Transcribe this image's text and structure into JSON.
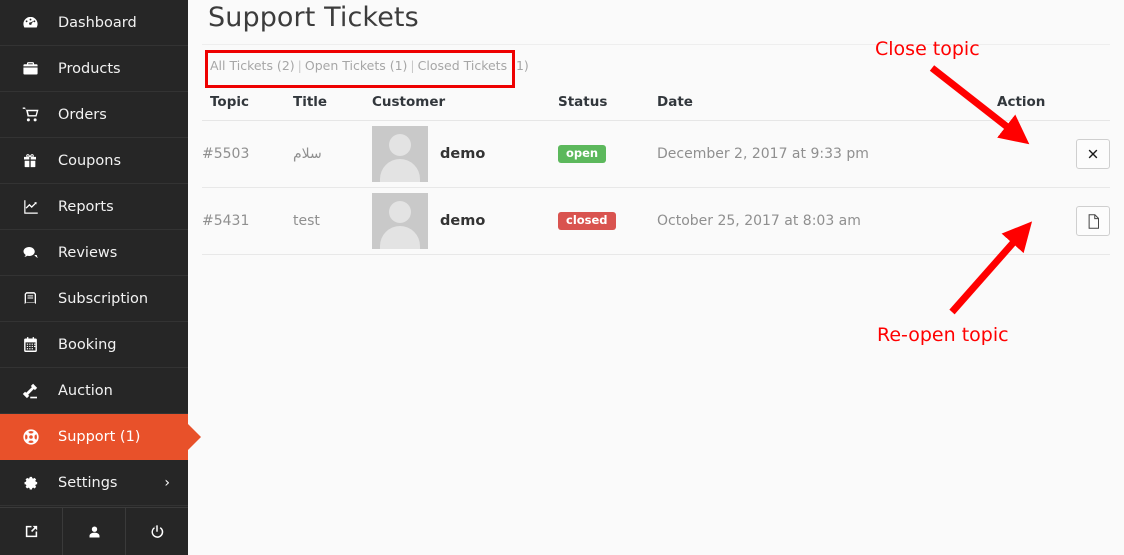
{
  "sidebar": {
    "items": [
      {
        "label": "Dashboard",
        "icon": "dashboard-icon",
        "active": false
      },
      {
        "label": "Products",
        "icon": "briefcase-icon",
        "active": false
      },
      {
        "label": "Orders",
        "icon": "cart-icon",
        "active": false
      },
      {
        "label": "Coupons",
        "icon": "gift-icon",
        "active": false
      },
      {
        "label": "Reports",
        "icon": "chart-icon",
        "active": false
      },
      {
        "label": "Reviews",
        "icon": "comment-icon",
        "active": false
      },
      {
        "label": "Subscription",
        "icon": "book-icon",
        "active": false
      },
      {
        "label": "Booking",
        "icon": "calendar-icon",
        "active": false
      },
      {
        "label": "Auction",
        "icon": "gavel-icon",
        "active": false
      },
      {
        "label": "Support (1)",
        "icon": "lifebuoy-icon",
        "active": true
      },
      {
        "label": "Settings",
        "icon": "gear-icon",
        "active": false,
        "chevron": "›"
      }
    ],
    "footer": [
      {
        "icon": "external-link-icon"
      },
      {
        "icon": "user-icon"
      },
      {
        "icon": "power-icon"
      }
    ],
    "colors": {
      "background": "#262626",
      "active": "#e8512a"
    }
  },
  "page": {
    "title": "Support Tickets"
  },
  "filters": {
    "all": "All Tickets (2)",
    "sep1": "|",
    "open": "Open Tickets (1)",
    "sep2": "|",
    "closed": "Closed Tickets (1)",
    "highlight_color": "#ee0000"
  },
  "table": {
    "columns": [
      "Topic",
      "Title",
      "Customer",
      "Status",
      "Date",
      "Action"
    ],
    "rows": [
      {
        "topic": "#5503",
        "title": "سلام",
        "customer": "demo",
        "avatar": "avatar-placeholder",
        "status": "open",
        "status_color": "#5cb85c",
        "date": "December 2, 2017 at 9:33 pm",
        "action_icon": "close-x-icon"
      },
      {
        "topic": "#5431",
        "title": "test",
        "customer": "demo",
        "avatar": "avatar-placeholder",
        "status": "closed",
        "status_color": "#d9534f",
        "date": "October 25, 2017 at 8:03 am",
        "action_icon": "file-icon"
      }
    ]
  },
  "annotations": {
    "close_topic": "Close topic",
    "reopen_topic": "Re-open topic",
    "color": "#ff0000"
  }
}
